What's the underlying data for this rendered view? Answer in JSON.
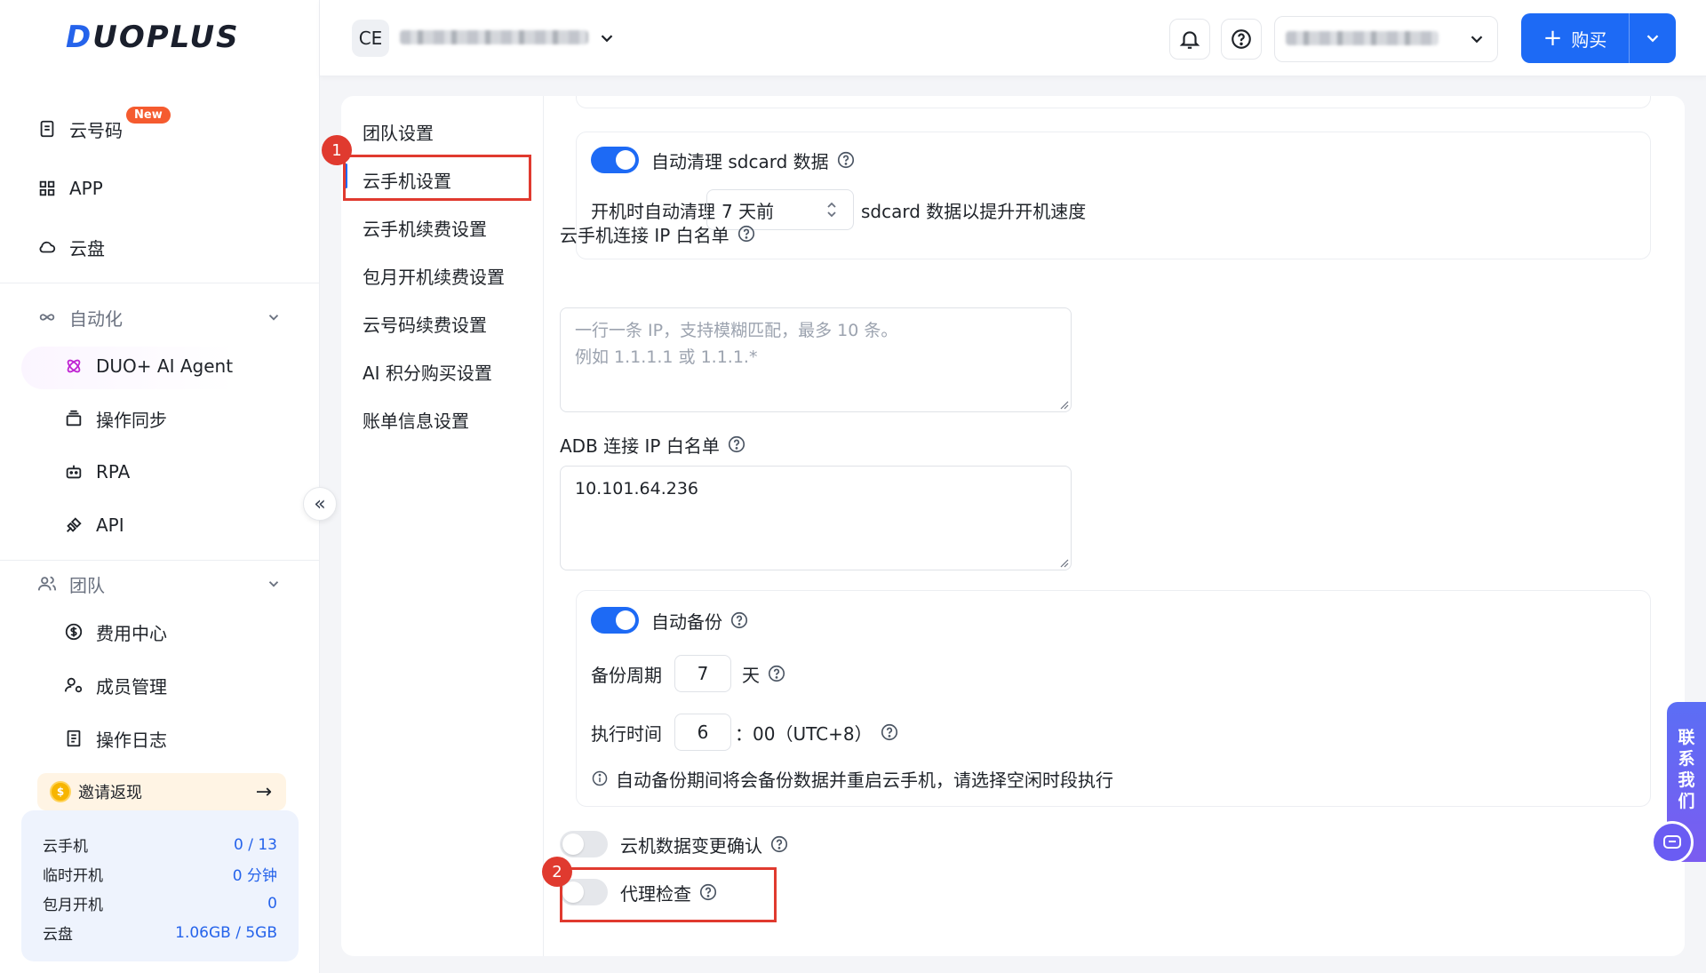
{
  "brand": {
    "logo_text_a": "D",
    "logo_text_b": "UOPLUS"
  },
  "sidebar": {
    "items": [
      {
        "label": "云号码",
        "icon": "phone-doc-icon",
        "badge": "New"
      },
      {
        "label": "APP",
        "icon": "grid-icon"
      },
      {
        "label": "云盘",
        "icon": "cloud-icon"
      }
    ],
    "automation": {
      "title": "自动化",
      "items": [
        {
          "label": "DUO+ AI Agent",
          "icon": "ai-agent-icon"
        },
        {
          "label": "操作同步",
          "icon": "sync-icon"
        },
        {
          "label": "RPA",
          "icon": "robot-icon"
        },
        {
          "label": "API",
          "icon": "api-icon"
        }
      ]
    },
    "team": {
      "title": "团队",
      "items": [
        {
          "label": "费用中心",
          "icon": "dollar-icon"
        },
        {
          "label": "成员管理",
          "icon": "member-icon"
        },
        {
          "label": "操作日志",
          "icon": "log-icon"
        }
      ]
    },
    "invite": {
      "label": "邀请返现",
      "arrow": "→"
    },
    "stats": [
      {
        "label": "云手机",
        "value": "0 / 13"
      },
      {
        "label": "临时开机",
        "value": "0 分钟"
      },
      {
        "label": "包月开机",
        "value": "0"
      },
      {
        "label": "云盘",
        "value": "1.06GB / 5GB"
      }
    ],
    "collapse_glyph": "«"
  },
  "topbar": {
    "workspace_badge": "CE",
    "buy_label": "购买",
    "buy_plus": "+"
  },
  "settings_nav": {
    "items": [
      "团队设置",
      "云手机设置",
      "云手机续费设置",
      "包月开机续费设置",
      "云号码续费设置",
      "AI 积分购买设置",
      "账单信息设置"
    ],
    "active": "云手机设置"
  },
  "annotations": {
    "one": "1",
    "two": "2"
  },
  "settings": {
    "sdcard": {
      "toggle_label": "自动清理 sdcard 数据",
      "enabled": true,
      "prefix": "开机时自动清理",
      "select_value": "7 天前",
      "suffix": "sdcard 数据以提升开机速度"
    },
    "ip_whitelist": {
      "label": "云手机连接 IP 白名单",
      "placeholder_line1": "一行一条 IP，支持模糊匹配，最多 10 条。",
      "placeholder_line2": "例如 1.1.1.1 或 1.1.1.*"
    },
    "adb_whitelist": {
      "label": "ADB 连接 IP 白名单",
      "value": "10.101.64.236"
    },
    "backup": {
      "toggle_label": "自动备份",
      "enabled": true,
      "period_label": "备份周期",
      "period_value": "7",
      "period_unit": "天",
      "time_label": "执行时间",
      "time_value": "6",
      "time_suffix": "：00（UTC+8）",
      "note": "自动备份期间将会备份数据并重启云手机，请选择空闲时段执行"
    },
    "change_confirm": {
      "label": "云机数据变更确认",
      "enabled": false
    },
    "proxy_check": {
      "label": "代理检查",
      "enabled": false
    }
  },
  "contact": {
    "chars": [
      "联",
      "系",
      "我",
      "们"
    ]
  },
  "colors": {
    "accent": "#1d6af5",
    "annotation": "#e03a2f",
    "badge": "#f55b2f"
  }
}
